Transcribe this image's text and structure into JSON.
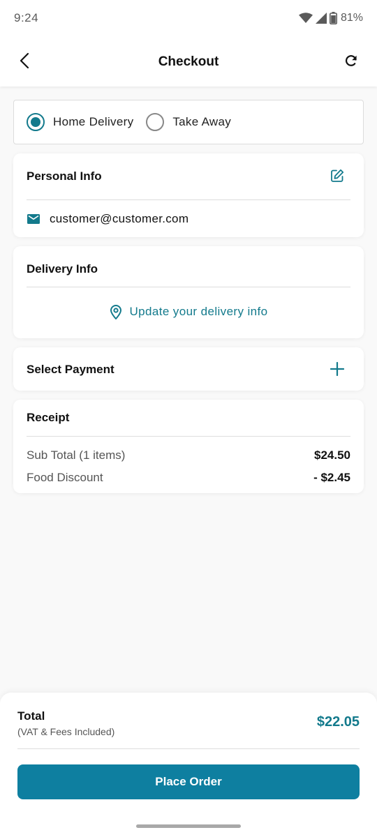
{
  "status_bar": {
    "time": "9:24",
    "battery": "81%",
    "icons": [
      "wifi-icon",
      "signal-icon",
      "battery-icon"
    ]
  },
  "app_bar": {
    "title": "Checkout",
    "back_icon": "arrow-left-icon",
    "refresh_icon": "refresh-icon"
  },
  "order_type": {
    "options": [
      {
        "label": "Home Delivery",
        "selected": true
      },
      {
        "label": "Take Away",
        "selected": false
      }
    ]
  },
  "personal_info": {
    "title": "Personal Info",
    "email": "customer@customer.com",
    "edit_icon": "edit-icon",
    "email_icon": "mail-icon"
  },
  "delivery_info": {
    "title": "Delivery Info",
    "link_label": "Update your delivery info",
    "link_icon": "location-pin-icon"
  },
  "payment": {
    "title": "Select Payment",
    "add_icon": "plus-icon"
  },
  "receipt": {
    "title": "Receipt",
    "rows": [
      {
        "label": "Sub Total (1 items)",
        "value": "$24.50"
      },
      {
        "label": "Food Discount",
        "value": "- $2.45"
      }
    ]
  },
  "summary": {
    "total_label": "Total",
    "total_note": "(VAT & Fees Included)",
    "total_value": "$22.05",
    "button_label": "Place Order"
  },
  "colors": {
    "accent": "#137a8c",
    "button": "#0e7fa0",
    "background": "#f9f9f9",
    "card": "#ffffff"
  }
}
